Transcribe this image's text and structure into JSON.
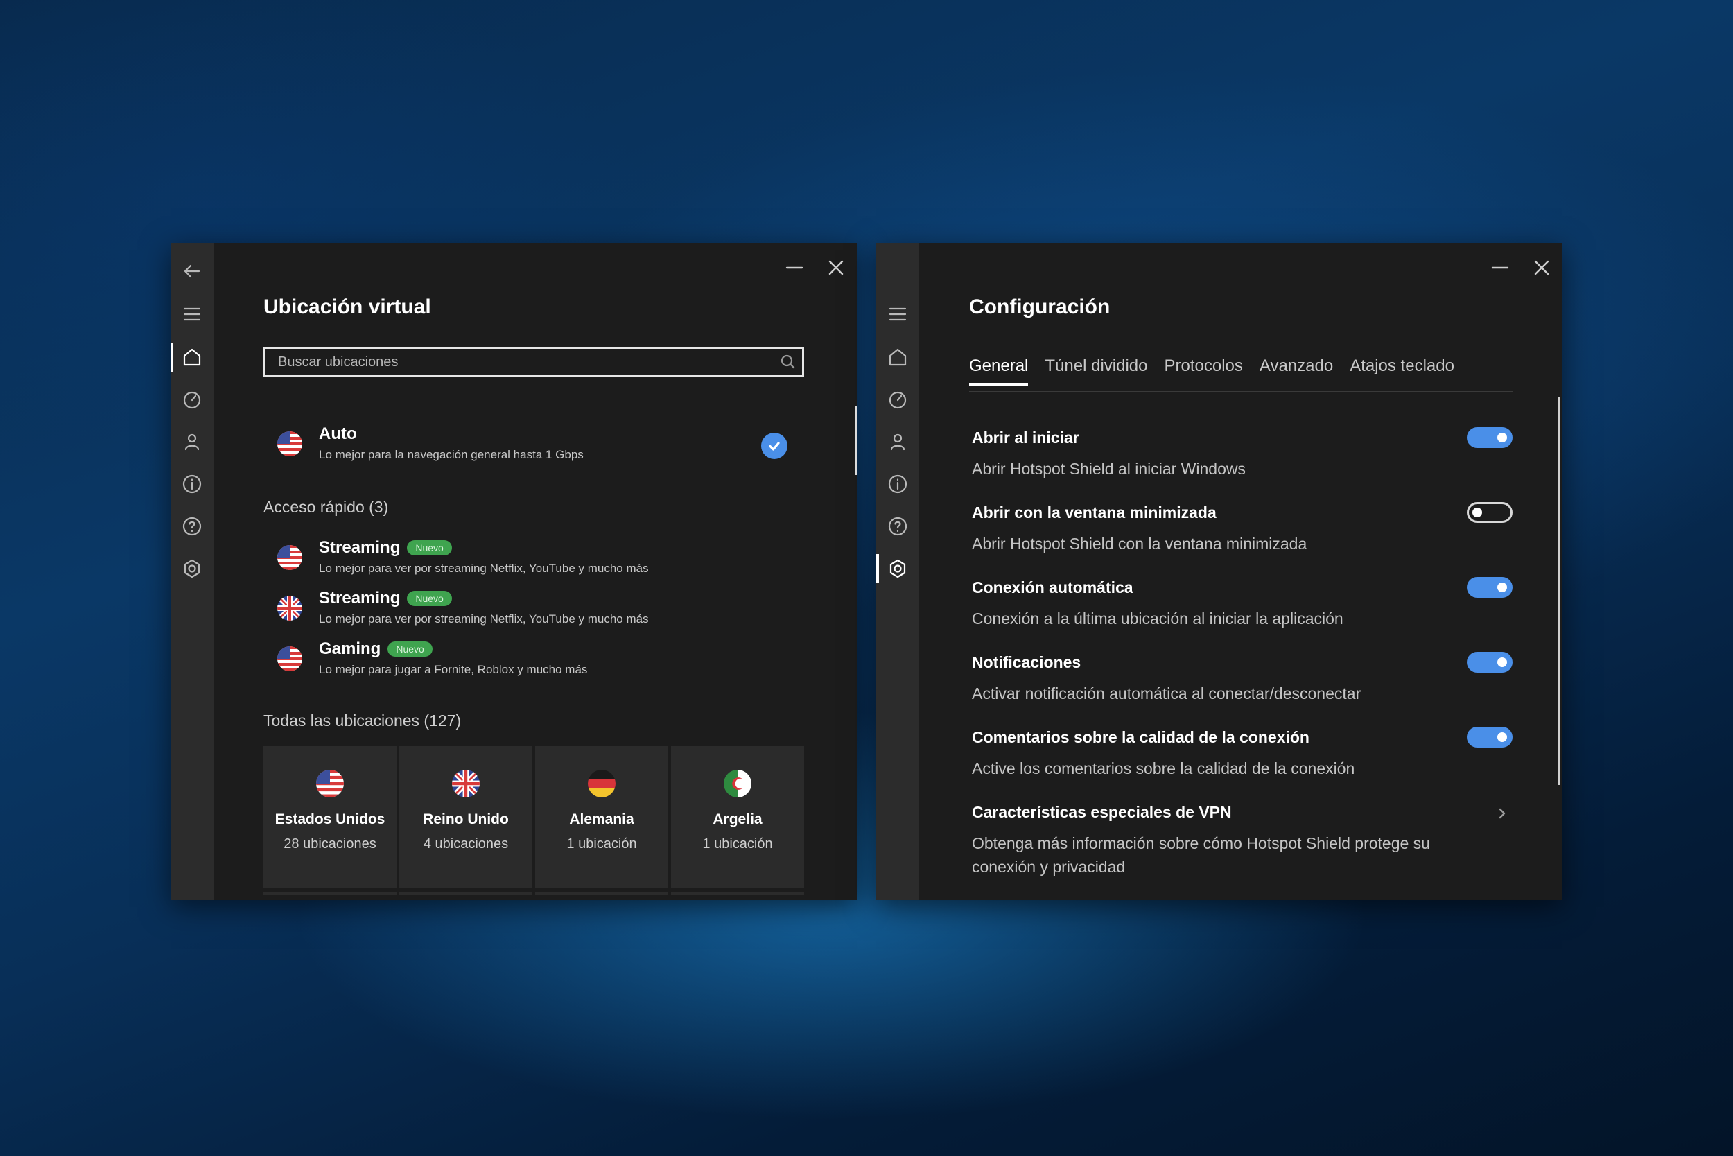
{
  "colors": {
    "accent": "#4a8fe8",
    "badge": "#3fa44f",
    "window_bg": "#1c1c1c",
    "sidebar_bg": "#2c2c2c"
  },
  "left": {
    "title": "Ubicación virtual",
    "search": {
      "placeholder": "Buscar ubicaciones"
    },
    "auto": {
      "name": "Auto",
      "desc": "Lo mejor para la navegación general hasta 1 Gbps",
      "flag": "us-flag",
      "selected": true
    },
    "quick_access": {
      "heading": "Acceso rápido (3)",
      "items": [
        {
          "name": "Streaming",
          "badge": "Nuevo",
          "desc": "Lo mejor para ver por streaming Netflix, YouTube y mucho más",
          "flag": "us-flag"
        },
        {
          "name": "Streaming",
          "badge": "Nuevo",
          "desc": "Lo mejor para ver por streaming Netflix, YouTube y mucho más",
          "flag": "uk-flag"
        },
        {
          "name": "Gaming",
          "badge": "Nuevo",
          "desc": "Lo mejor para jugar a Fornite, Roblox y mucho más",
          "flag": "us-flag"
        }
      ]
    },
    "all_locations": {
      "heading": "Todas las ubicaciones (127)",
      "cards": [
        {
          "name": "Estados Unidos",
          "count": "28 ubicaciones",
          "flag": "us-flag"
        },
        {
          "name": "Reino Unido",
          "count": "4 ubicaciones",
          "flag": "uk-flag"
        },
        {
          "name": "Alemania",
          "count": "1 ubicación",
          "flag": "de-flag"
        },
        {
          "name": "Argelia",
          "count": "1 ubicación",
          "flag": "dz-flag"
        }
      ]
    }
  },
  "right": {
    "title": "Configuración",
    "tabs": [
      "General",
      "Túnel dividido",
      "Protocolos",
      "Avanzado",
      "Atajos teclado"
    ],
    "active_tab": "General",
    "settings": [
      {
        "title": "Abrir al iniciar",
        "desc": "Abrir Hotspot Shield al iniciar Windows",
        "enabled": true
      },
      {
        "title": "Abrir con la ventana minimizada",
        "desc": "Abrir Hotspot Shield con la ventana minimizada",
        "enabled": false
      },
      {
        "title": "Conexión automática",
        "desc": "Conexión a la última ubicación al iniciar la aplicación",
        "enabled": true
      },
      {
        "title": "Notificaciones",
        "desc": "Activar notificación automática al conectar/desconectar",
        "enabled": true
      },
      {
        "title": "Comentarios sobre la calidad de la conexión",
        "desc": "Active los comentarios sobre la calidad de la conexión",
        "enabled": true
      },
      {
        "title": "Características especiales de VPN",
        "desc": "Obtenga más información sobre cómo Hotspot Shield protege su conexión y privacidad",
        "has_chevron": true
      }
    ]
  }
}
